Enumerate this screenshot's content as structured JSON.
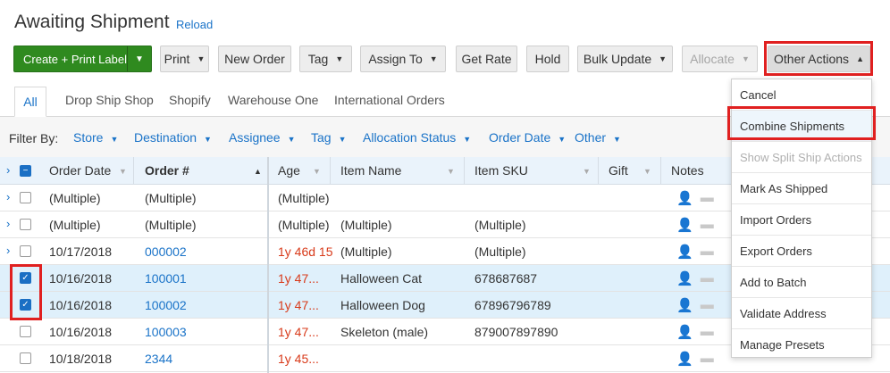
{
  "header": {
    "title": "Awaiting Shipment",
    "reload": "Reload"
  },
  "toolbar": {
    "create_label": "Create + Print Label",
    "print": "Print",
    "new_order": "New Order",
    "tag": "Tag",
    "assign_to": "Assign To",
    "get_rate": "Get Rate",
    "hold": "Hold",
    "bulk_update": "Bulk Update",
    "allocate": "Allocate",
    "other_actions": "Other Actions"
  },
  "tabs": [
    "All",
    "Drop Ship Shop",
    "Shopify",
    "Warehouse One",
    "International Orders"
  ],
  "filters": {
    "label": "Filter By:",
    "items": [
      "Store",
      "Destination",
      "Assignee",
      "Tag",
      "Allocation Status",
      "Order Date",
      "Other"
    ]
  },
  "columns": [
    "Order Date",
    "Order #",
    "Age",
    "Item Name",
    "Item SKU",
    "Gift",
    "Notes"
  ],
  "rows": [
    {
      "date": "(Multiple)",
      "order": "(Multiple)",
      "age": "(Multiple)",
      "item": "",
      "sku": ""
    },
    {
      "date": "(Multiple)",
      "order": "(Multiple)",
      "age": "(Multiple)",
      "item": "(Multiple)",
      "sku": "(Multiple)"
    },
    {
      "date": "10/17/2018",
      "order": "000002",
      "age": "1y 46d 15",
      "item": "(Multiple)",
      "sku": "(Multiple)"
    },
    {
      "date": "10/16/2018",
      "order": "100001",
      "age": "1y 47...",
      "item": "Halloween Cat",
      "sku": "678687687"
    },
    {
      "date": "10/16/2018",
      "order": "100002",
      "age": "1y 47...",
      "item": "Halloween Dog",
      "sku": "67896796789"
    },
    {
      "date": "10/16/2018",
      "order": "100003",
      "age": "1y 47...",
      "item": "Skeleton (male)",
      "sku": "879007897890"
    },
    {
      "date": "10/18/2018",
      "order": "2344",
      "age": "1y 45...",
      "item": "",
      "sku": ""
    }
  ],
  "menu": [
    "Cancel",
    "Combine Shipments",
    "Show Split Ship Actions",
    "Mark As Shipped",
    "Import Orders",
    "Export Orders",
    "Add to Batch",
    "Validate Address",
    "Manage Presets"
  ],
  "icons": {
    "caret": "caret-down-icon",
    "expand": "chevron-right-icon",
    "assign_note": "person-icon",
    "comment_note": "comment-icon"
  },
  "colors": {
    "accent": "#1a73c8",
    "primary_button": "#2f8a1f",
    "highlight": "#e02020",
    "selected_row": "#dff0fb",
    "age_warning": "#d83a1a"
  }
}
